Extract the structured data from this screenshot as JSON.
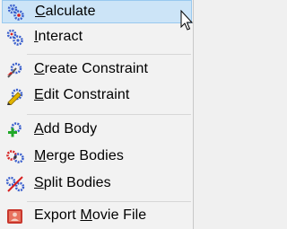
{
  "menu": {
    "items": [
      {
        "pre": "",
        "key": "C",
        "post": "alculate",
        "icon": "gears-calculate-icon"
      },
      {
        "pre": "",
        "key": "I",
        "post": "nteract",
        "icon": "gears-interact-icon"
      },
      {
        "pre": "",
        "key": "C",
        "post": "reate Constraint",
        "icon": "create-constraint-icon"
      },
      {
        "pre": "",
        "key": "E",
        "post": "dit Constraint",
        "icon": "edit-constraint-icon"
      },
      {
        "pre": "",
        "key": "A",
        "post": "dd Body",
        "icon": "add-body-icon"
      },
      {
        "pre": "",
        "key": "M",
        "post": "erge Bodies",
        "icon": "merge-bodies-icon"
      },
      {
        "pre": "",
        "key": "S",
        "post": "plit Bodies",
        "icon": "split-bodies-icon"
      },
      {
        "pre": "Export ",
        "key": "M",
        "post": "ovie File",
        "icon": "movie-file-icon"
      }
    ]
  },
  "colors": {
    "highlight": "#cce4f7",
    "gear_blue": "#3a5fcd",
    "gear_red": "#d62020",
    "add_green": "#21a829"
  }
}
